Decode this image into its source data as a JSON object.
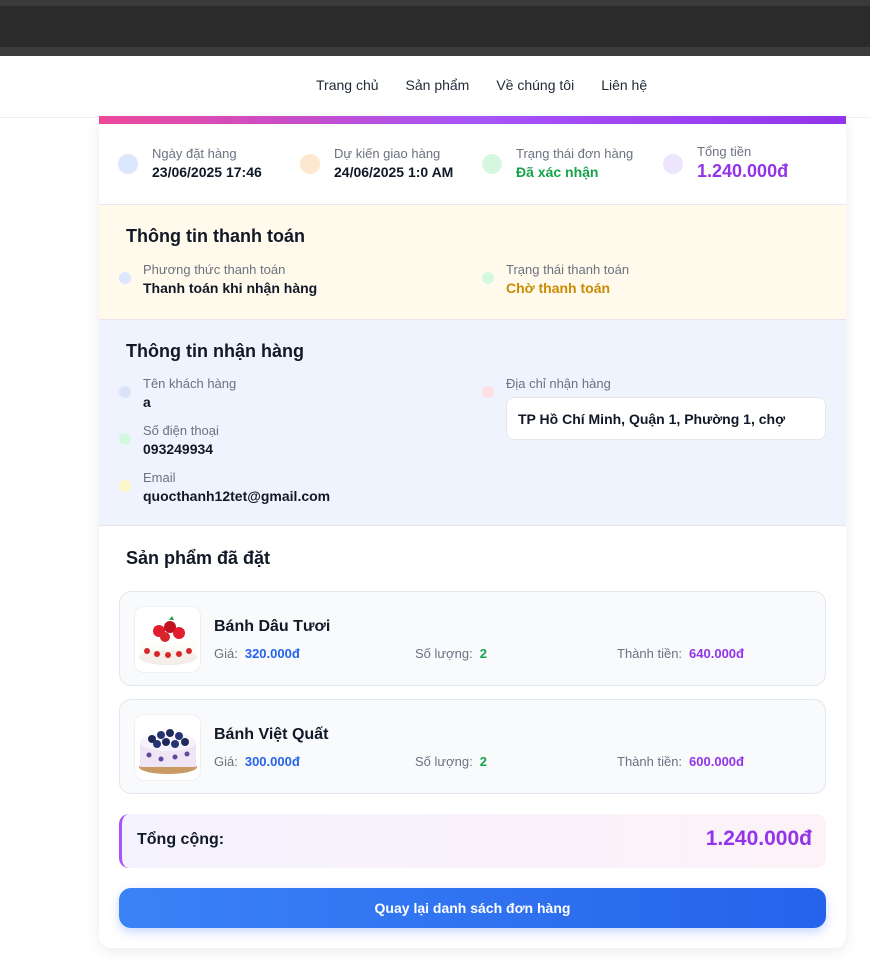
{
  "nav": {
    "items": [
      "Trang chủ",
      "Sản phẩm",
      "Về chúng tôi",
      "Liên hệ"
    ]
  },
  "summary": {
    "order_date_label": "Ngày đặt hàng",
    "order_date": "23/06/2025 17:46",
    "delivery_label": "Dự kiến giao hàng",
    "delivery": "24/06/2025 1:0 AM",
    "status_label": "Trạng thái đơn hàng",
    "status": "Đã xác nhận",
    "total_label": "Tổng tiền",
    "total": "1.240.000đ"
  },
  "payment": {
    "title": "Thông tin thanh toán",
    "method_label": "Phương thức thanh toán",
    "method": "Thanh toán khi nhận hàng",
    "status_label": "Trạng thái thanh toán",
    "status": "Chờ thanh toán"
  },
  "receiver": {
    "title": "Thông tin nhận hàng",
    "name_label": "Tên khách hàng",
    "name": "a",
    "phone_label": "Số điện thoại",
    "phone": "093249934",
    "email_label": "Email",
    "email": "quocthanh12tet@gmail.com",
    "address_label": "Địa chỉ nhận hàng",
    "address": "TP Hồ Chí Minh, Quận 1, Phường 1, chợ"
  },
  "products": {
    "title": "Sản phẩm đã đặt",
    "price_label": "Giá:",
    "qty_label": "Số lượng:",
    "subtotal_label": "Thành tiền:",
    "items": [
      {
        "name": "Bánh Dâu Tươi",
        "price": "320.000đ",
        "qty": "2",
        "subtotal": "640.000đ"
      },
      {
        "name": "Bánh Việt Quất",
        "price": "300.000đ",
        "qty": "2",
        "subtotal": "600.000đ"
      }
    ]
  },
  "total": {
    "label": "Tổng cộng:",
    "value": "1.240.000đ"
  },
  "back_button": "Quay lại danh sách đơn hàng",
  "colors": {
    "accent_purple": "#9333ea",
    "accent_blue": "#2563eb",
    "status_green": "#16a34a",
    "pending_amber": "#ca8a04"
  }
}
